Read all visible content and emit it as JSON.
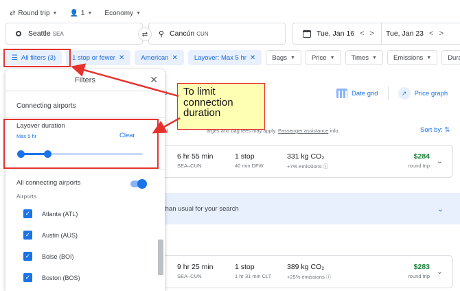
{
  "trip_bar": {
    "trip_type": "Round trip",
    "passengers": "1",
    "cabin": "Economy"
  },
  "search": {
    "origin_city": "Seattle",
    "origin_code": "SEA",
    "destination_city": "Cancún",
    "destination_code": "CUN",
    "depart_date": "Tue, Jan 16",
    "return_date": "Tue, Jan 23"
  },
  "chips": {
    "all_filters": "All filters (3)",
    "stops": "1 stop or fewer",
    "airline": "American",
    "layover": "Layover: Max 5 hr",
    "bags": "Bags",
    "price": "Price",
    "times": "Times",
    "emissions": "Emissions",
    "duration": "Durati"
  },
  "filters_panel": {
    "title": "Filters",
    "section_connecting": "Connecting airports",
    "layover_title": "Layover duration",
    "layover_value": "Max 5 hr",
    "layover_fraction": 0.22,
    "clear_label": "Clear",
    "all_connecting": "All connecting airports",
    "all_connecting_on": true,
    "airports_label": "Airports",
    "airports": [
      "Atlanta (ATL)",
      "Austin (AUS)",
      "Boise (BOI)",
      "Boston (BOS)"
    ]
  },
  "results": {
    "any_dates": "ny d",
    "date_grid": "Date grid",
    "price_graph": "Price graph",
    "required_text": "uired",
    "fees_text": "arges and bag fees may apply.",
    "passenger_assistance": "Passenger assistance",
    "info": "info.",
    "sort_by": "Sort by:",
    "flights": [
      {
        "duration": "6 hr 55 min",
        "route": "SEA–CUN",
        "stops": "1 stop",
        "layover": "40 min DFW",
        "co2": "331 kg CO₂",
        "emissions": "+7% emissions ⓘ",
        "price": "$284",
        "price_note": "round trip"
      },
      {
        "duration": "9 hr 25 min",
        "route": "SEA–CUN",
        "stops": "1 stop",
        "layover": "1 hr 31 min CLT",
        "co2": "389 kg CO₂",
        "emissions": "+25% emissions ⓘ",
        "price": "$283",
        "price_note": "round trip"
      }
    ],
    "notice": "than usual for your search"
  },
  "annotation": {
    "callout_text": "To limit connection duration",
    "box_color": "#e5322d",
    "callout_bg": "#ffffb3"
  },
  "colors": {
    "accent": "#1a73e8",
    "chip_active_bg": "#e8f0fe",
    "price_green": "#188038"
  }
}
